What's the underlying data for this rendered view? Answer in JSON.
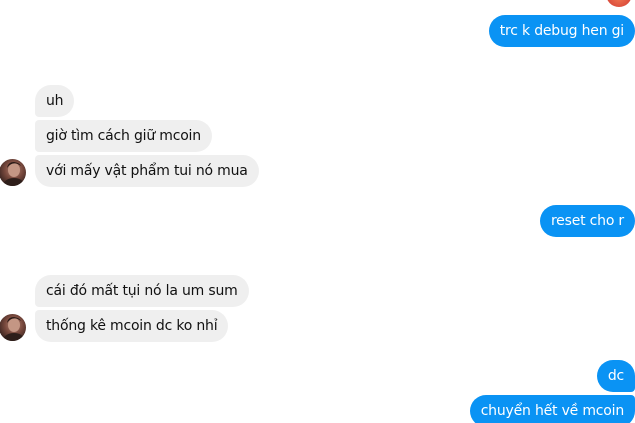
{
  "conversation": {
    "messages": [
      {
        "direction": "outgoing",
        "text": "trc k debug hen gi"
      },
      {
        "direction": "incoming",
        "text": "uh"
      },
      {
        "direction": "incoming",
        "text": "giờ tìm cách giữ mcoin"
      },
      {
        "direction": "incoming",
        "text": "với mấy vật phẩm tui nó mua"
      },
      {
        "direction": "outgoing",
        "text": "reset cho r"
      },
      {
        "direction": "incoming",
        "text": "cái đó mất tụi nó la um sum"
      },
      {
        "direction": "incoming",
        "text": "thống kê mcoin dc ko nhỉ"
      },
      {
        "direction": "outgoing",
        "text": "dc"
      },
      {
        "direction": "outgoing",
        "text": "chuyển hết về mcoin"
      }
    ]
  },
  "colors": {
    "outgoing_bubble": "#0a93f4",
    "incoming_bubble": "#efefef",
    "background": "#ffffff"
  }
}
